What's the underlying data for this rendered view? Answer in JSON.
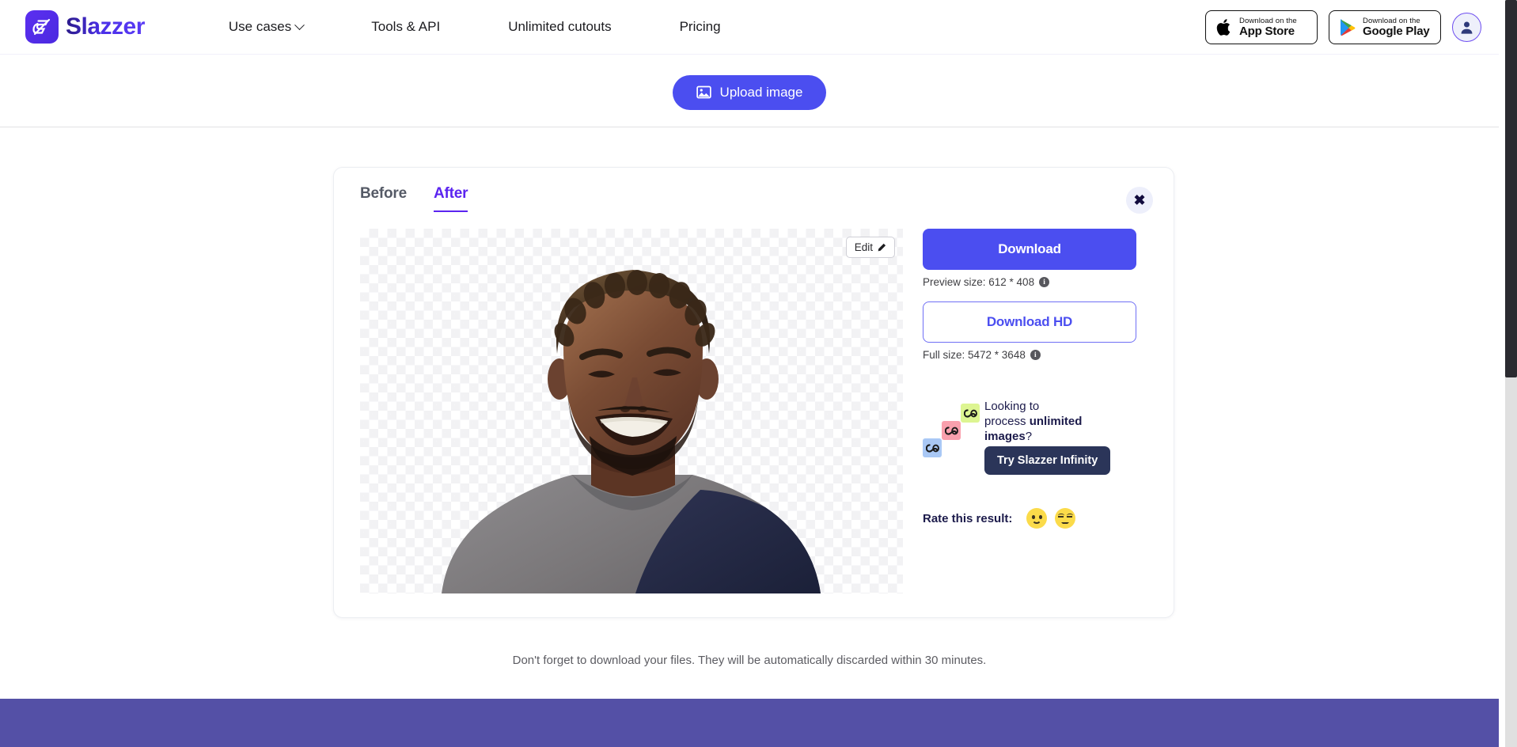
{
  "header": {
    "brand_name": "Slazzer",
    "nav": [
      {
        "label": "Use cases",
        "has_dropdown": true
      },
      {
        "label": "Tools & API",
        "has_dropdown": false
      },
      {
        "label": "Unlimited cutouts",
        "has_dropdown": false
      },
      {
        "label": "Pricing",
        "has_dropdown": false
      }
    ],
    "app_store": {
      "small": "Download on the",
      "big": "App Store"
    },
    "google_play": {
      "small": "Download on the",
      "big": "Google Play"
    }
  },
  "upload": {
    "button_label": "Upload image"
  },
  "card": {
    "tabs": [
      {
        "label": "Before",
        "active": false
      },
      {
        "label": "After",
        "active": true
      }
    ],
    "close_label": "✖",
    "edit_label": "Edit",
    "download_label": "Download",
    "preview_size_label": "Preview size: 612 * 408",
    "download_hd_label": "Download HD",
    "full_size_label": "Full size: 5472 * 3648",
    "info_glyph": "i",
    "promo": {
      "line1": "Looking to",
      "line2_prefix": "process ",
      "line2_bold": "unlimited",
      "line3_bold": "images",
      "line3_suffix": "?",
      "button_label": "Try Slazzer Infinity"
    },
    "rate": {
      "label": "Rate this result:",
      "happy_name": "happy-emoji",
      "sad_name": "sad-emoji"
    }
  },
  "footer_note": "Don't forget to download your files. They will be automatically discarded within 30 minutes.",
  "colors": {
    "brand_purple": "#4b4ef0",
    "tab_active": "#5b24f0",
    "promo_button": "#2b3559",
    "footer_band": "#5450a6",
    "emoji_yellow": "#fbdb4a"
  }
}
